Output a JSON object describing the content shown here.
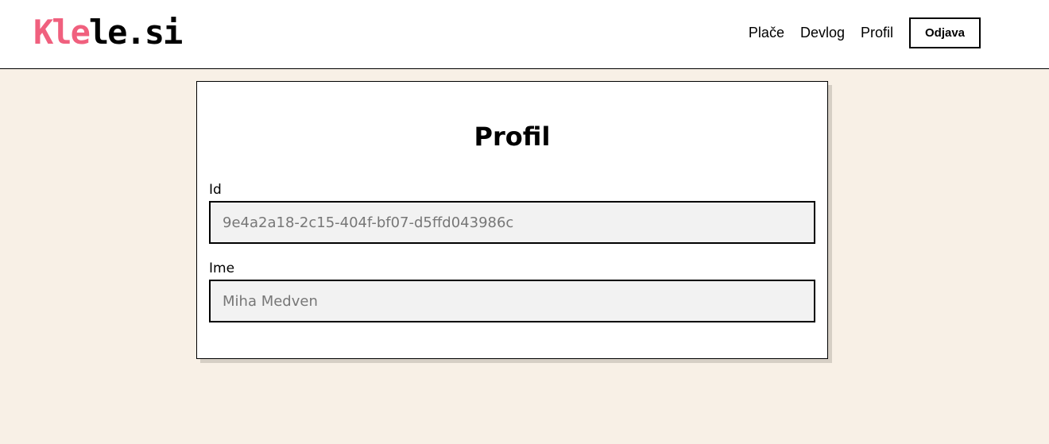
{
  "header": {
    "logo": {
      "accent": "Kle",
      "rest": "le.si"
    },
    "nav": {
      "place": "Plače",
      "devlog": "Devlog",
      "profil": "Profil",
      "logout": "Odjava"
    }
  },
  "profile": {
    "title": "Profil",
    "id_label": "Id",
    "id_value": "9e4a2a18-2c15-404f-bf07-d5ffd043986c",
    "name_label": "Ime",
    "name_value": "Miha Medven"
  },
  "colors": {
    "accent": "#f0607e",
    "background": "#f8f0e6"
  }
}
